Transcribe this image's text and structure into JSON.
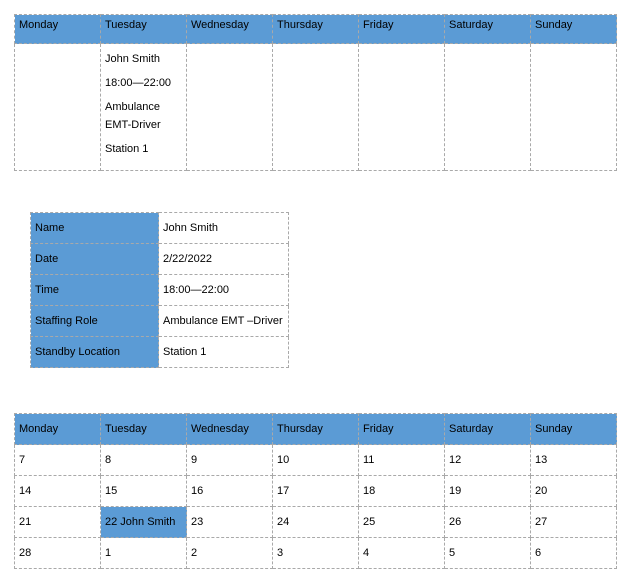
{
  "weekdays": [
    "Monday",
    "Tuesday",
    "Wednesday",
    "Thursday",
    "Friday",
    "Saturday",
    "Sunday"
  ],
  "week_entry": {
    "name": "John Smith",
    "time": "18:00—22:00",
    "role_line1": "Ambulance",
    "role_line2": "EMT-Driver",
    "location": "Station 1"
  },
  "detail": {
    "rows": [
      {
        "label": "Name",
        "value": "John Smith"
      },
      {
        "label": "Date",
        "value": "2/22/2022"
      },
      {
        "label": "Time",
        "value": "18:00—22:00"
      },
      {
        "label": "Staffing Role",
        "value": "Ambulance EMT –Driver"
      },
      {
        "label": "Standby Location",
        "value": "Station 1"
      }
    ]
  },
  "month": {
    "weeks": [
      [
        "7",
        "8",
        "9",
        "10",
        "11",
        "12",
        "13"
      ],
      [
        "14",
        "15",
        "16",
        "17",
        "18",
        "19",
        "20"
      ],
      [
        "21",
        "22 John Smith",
        "23",
        "24",
        "25",
        "26",
        "27"
      ],
      [
        "28",
        "1",
        "2",
        "3",
        "4",
        "5",
        "6"
      ]
    ]
  },
  "colors": {
    "header_blue": "#5b9bd5",
    "border": "#a9a9a9"
  }
}
